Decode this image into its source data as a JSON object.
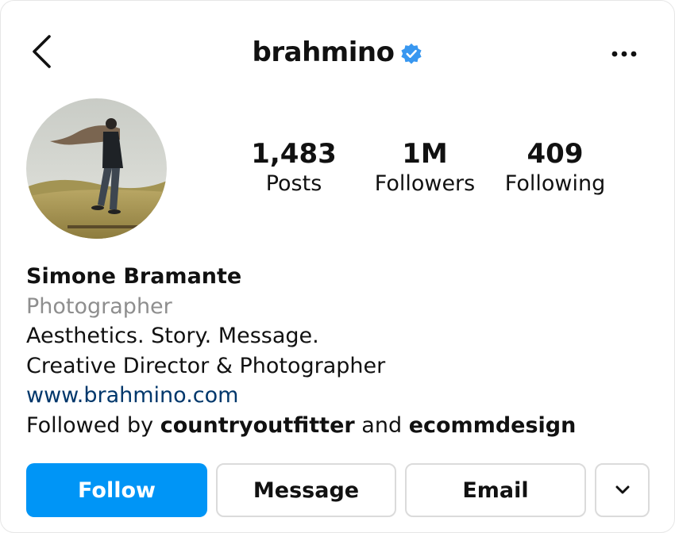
{
  "header": {
    "username": "brahmino",
    "verified": true,
    "icons": {
      "back": "chevron-left-icon",
      "verified": "verified-badge-icon",
      "more": "more-horizontal-icon"
    }
  },
  "stats": {
    "posts": {
      "value": "1,483",
      "label": "Posts"
    },
    "followers": {
      "value": "1M",
      "label": "Followers"
    },
    "following": {
      "value": "409",
      "label": "Following"
    }
  },
  "bio": {
    "name": "Simone Bramante",
    "category": "Photographer",
    "line1": "Aesthetics. Story. Message.",
    "line2": "Creative Director & Photographer",
    "link": "www.brahmino.com",
    "followed_by_prefix": "Followed by",
    "followed_by_user1": "countryoutfitter",
    "followed_by_and": "and",
    "followed_by_user2": "ecommdesign"
  },
  "actions": {
    "follow": "Follow",
    "message": "Message",
    "email": "Email",
    "dropdown_icon": "chevron-down-icon"
  },
  "colors": {
    "accent": "#0095f6",
    "verified": "#3897f0",
    "link": "#00376b",
    "muted": "#8e8e8e",
    "border": "#dbdbdb"
  }
}
